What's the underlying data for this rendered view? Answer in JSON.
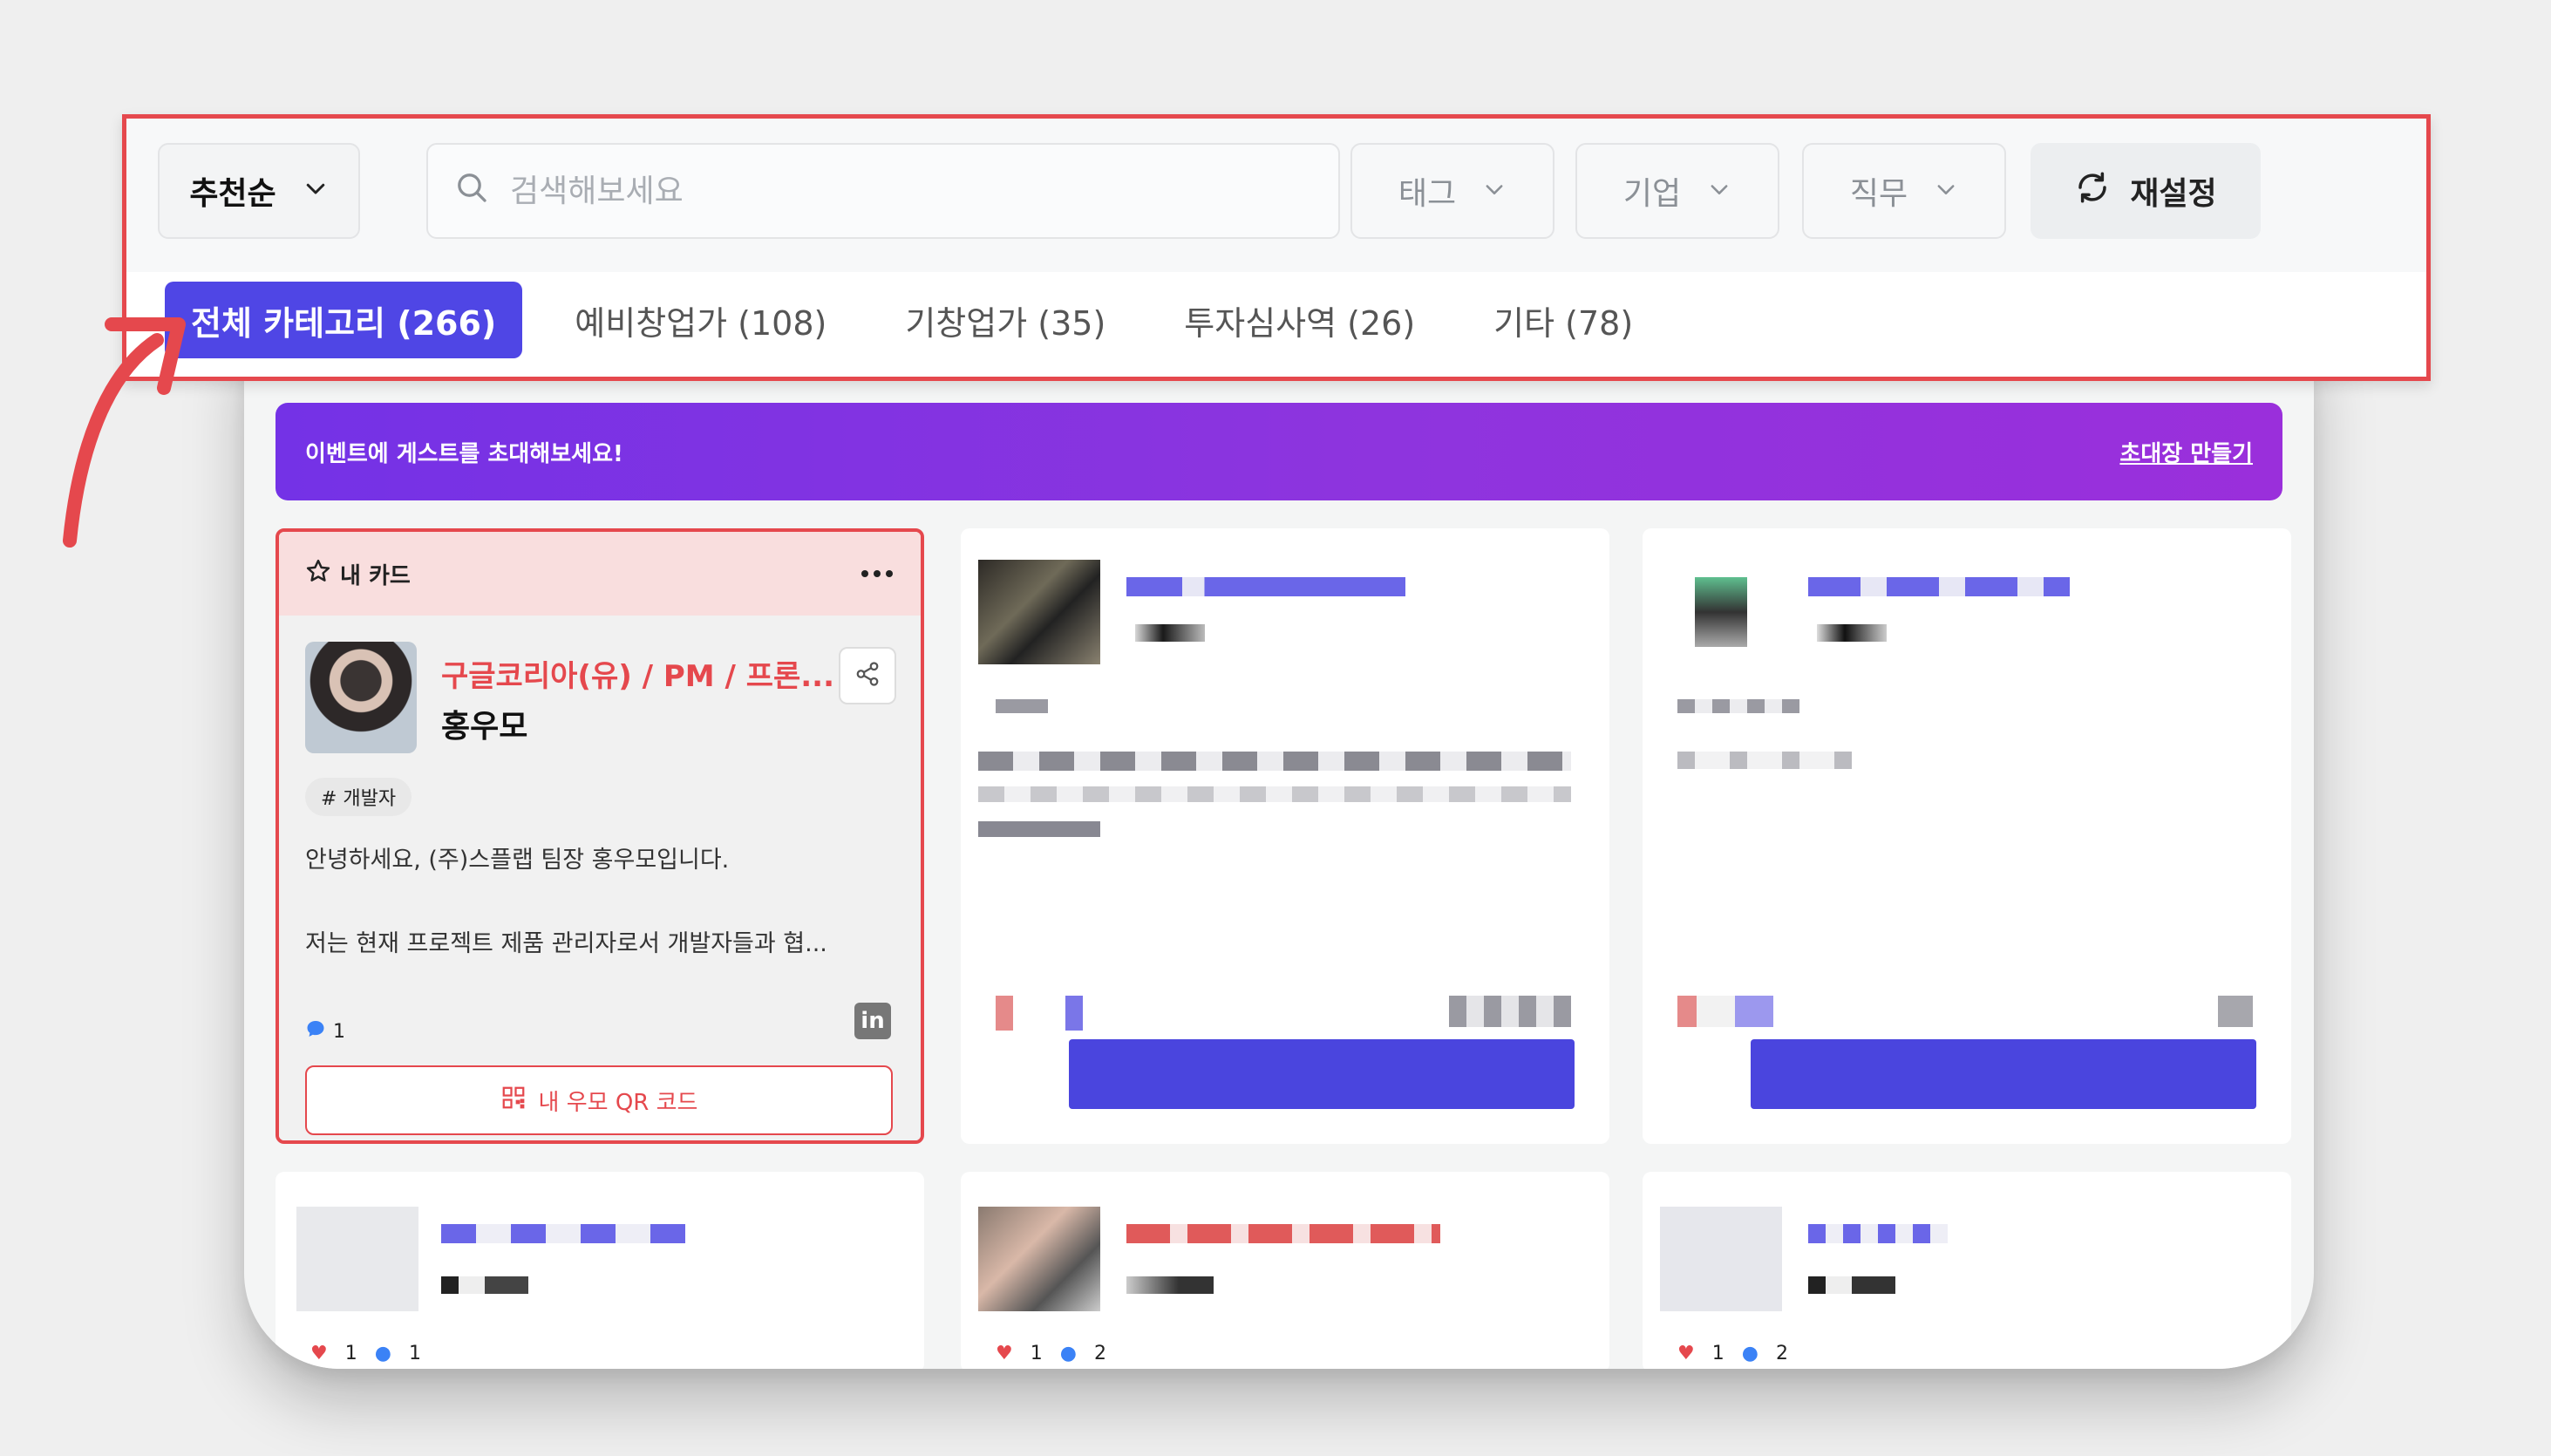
{
  "filters": {
    "sort_label": "추천순",
    "search_placeholder": "검색해보세요",
    "tag_label": "태그",
    "company_label": "기업",
    "job_label": "직무",
    "reset_label": "재설정"
  },
  "tabs": [
    {
      "label": "전체 카테고리 (266)",
      "active": true
    },
    {
      "label": "예비창업가 (108)",
      "active": false
    },
    {
      "label": "기창업가 (35)",
      "active": false
    },
    {
      "label": "투자심사역 (26)",
      "active": false
    },
    {
      "label": "기타 (78)",
      "active": false
    }
  ],
  "banner": {
    "text": "이벤트에 게스트를 초대해보세요!",
    "link": "초대장 만들기"
  },
  "my_card": {
    "header": "내 카드",
    "company": "구글코리아(유) / PM / 프론...",
    "name": "홍우모",
    "tag": "# 개발자",
    "intro1": "안녕하세요, (주)스플랩 팀장 홍우모입니다.",
    "intro2": "저는 현재 프로젝트 제품 관리자로서 개발자들과 협...",
    "comments": "1",
    "linkedin": "in",
    "qr_button": "내 우모 QR 코드"
  },
  "bottom_counts": [
    {
      "hearts": "1",
      "comments": "1"
    },
    {
      "hearts": "1",
      "comments": "2"
    },
    {
      "hearts": "1",
      "comments": "2"
    }
  ],
  "colors": {
    "accent": "#4f46e5",
    "highlight": "#e5484d",
    "banner_start": "#7432e6",
    "banner_end": "#9a2fdb"
  }
}
